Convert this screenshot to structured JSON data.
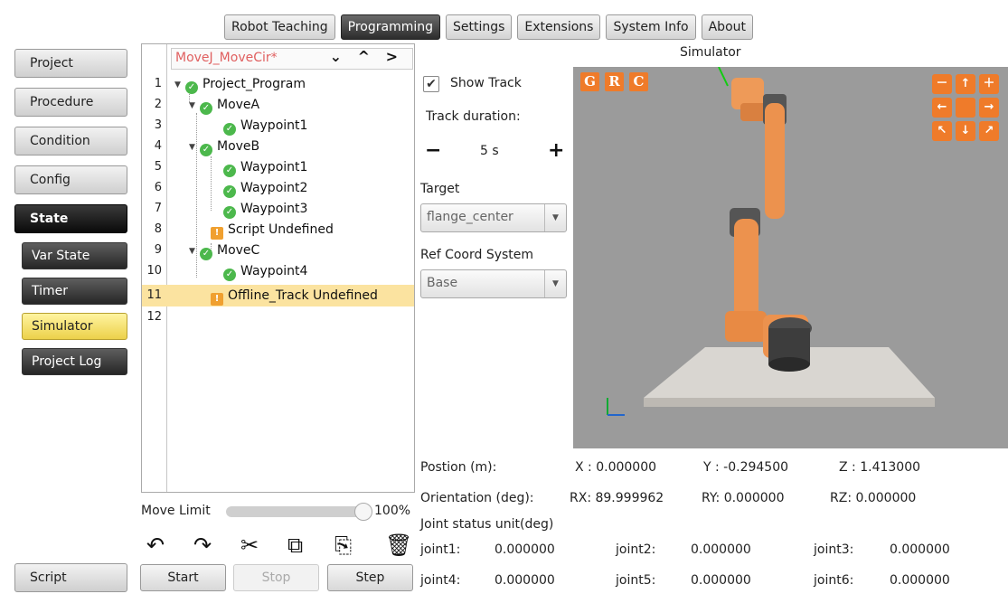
{
  "top_tabs": [
    "Robot Teaching",
    "Programming",
    "Settings",
    "Extensions",
    "System Info",
    "About"
  ],
  "active_tab": "Programming",
  "sidebar": {
    "items": [
      "Project",
      "Procedure",
      "Condition",
      "Config",
      "State"
    ],
    "state_sub": [
      "Var State",
      "Timer",
      "Simulator",
      "Project Log"
    ],
    "selected_sub": "Simulator",
    "script": "Script"
  },
  "program": {
    "file_name": "MoveJ_MoveCir*",
    "nav": "⌄ ^ >",
    "line_numbers": [
      "1",
      "2",
      "3",
      "4",
      "5",
      "6",
      "7",
      "8",
      "9",
      "10",
      "11",
      "12"
    ],
    "nodes": [
      {
        "label": "Project_Program"
      },
      {
        "label": "MoveA"
      },
      {
        "label": "Waypoint1"
      },
      {
        "label": "MoveB"
      },
      {
        "label": "Waypoint1"
      },
      {
        "label": "Waypoint2"
      },
      {
        "label": "Waypoint3"
      },
      {
        "label": "Script Undefined"
      },
      {
        "label": "MoveC"
      },
      {
        "label": "Waypoint4"
      },
      {
        "label": "Offline_Track Undefined"
      }
    ]
  },
  "move_limit": {
    "label": "Move Limit",
    "value": "100%",
    "fraction": 1.0
  },
  "actions": {
    "start": "Start",
    "stop": "Stop",
    "step": "Step"
  },
  "simulator": {
    "title": "Simulator",
    "show_track": "Show Track",
    "show_track_checked": true,
    "track_duration_label": "Track duration:",
    "track_duration": "5 s",
    "minus": "−",
    "plus": "+",
    "target_label": "Target",
    "target_value": "flange_center",
    "ref_label": "Ref Coord System",
    "ref_value": "Base",
    "view_buttons": [
      "G",
      "R",
      "C"
    ],
    "accent": "#ef7b2a"
  },
  "readouts": {
    "position_label": "Postion (m):",
    "x": "X : 0.000000",
    "y": "Y : -0.294500",
    "z": "Z : 1.413000",
    "orientation_label": "Orientation (deg):",
    "rx": "RX: 89.999962",
    "ry": "RY: 0.000000",
    "rz": "RZ: 0.000000",
    "joint_label": "Joint status unit(deg)",
    "joints": [
      {
        "name": "joint1:",
        "value": "0.000000"
      },
      {
        "name": "joint2:",
        "value": "0.000000"
      },
      {
        "name": "joint3:",
        "value": "0.000000"
      },
      {
        "name": "joint4:",
        "value": "0.000000"
      },
      {
        "name": "joint5:",
        "value": "0.000000"
      },
      {
        "name": "joint6:",
        "value": "0.000000"
      }
    ]
  }
}
